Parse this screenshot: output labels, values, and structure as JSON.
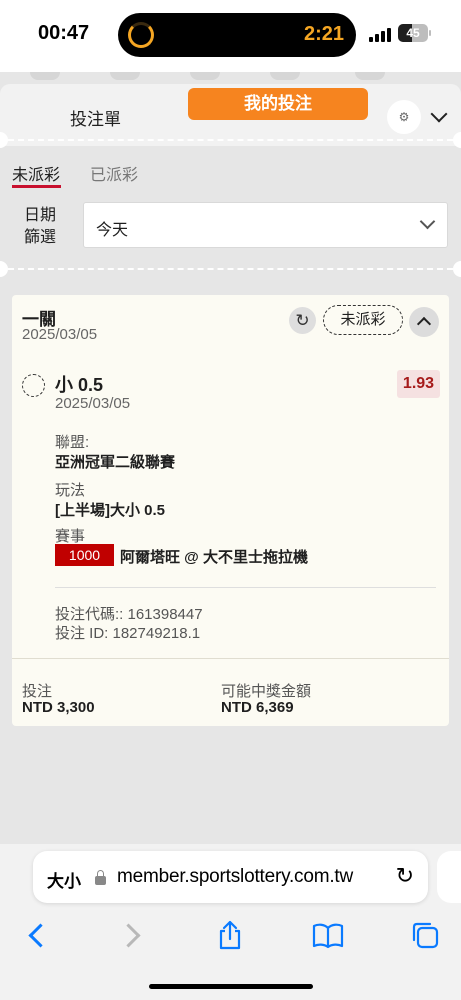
{
  "status_bar": {
    "time": "00:47",
    "timer": "2:21",
    "battery": "45",
    "battery_level": 0.45
  },
  "header": {
    "tab_betslip": "投注單",
    "tab_mybets": "我的投注",
    "settings_icon": "gear-icon",
    "collapse_icon": "chevron-down-icon"
  },
  "subtabs": {
    "unsettled": "未派彩",
    "settled": "已派彩"
  },
  "filter": {
    "label_line1": "日期",
    "label_line2": "篩選",
    "value": "今天"
  },
  "bet": {
    "type": "一關",
    "date": "2025/03/05",
    "status": "未派彩",
    "selection": "小 0.5",
    "selection_date": "2025/03/05",
    "odds": "1.93",
    "league_label": "聯盟:",
    "league": "亞洲冠軍二級聯賽",
    "market_label": "玩法",
    "market": "[上半場]大小 0.5",
    "event_label": "賽事",
    "event_id": "1000",
    "event_name": "阿爾塔旺 @ 大不里士拖拉機",
    "code_line": "投注代碼:: 161398447",
    "id_line": "投注 ID: 182749218.1",
    "stake_label": "投注",
    "stake": "NTD 3,300",
    "payout_label": "可能中獎金額",
    "payout": "NTD 6,369"
  },
  "browser": {
    "text_size": "大小",
    "url": "member.sportslottery.com.tw",
    "icons": [
      "back-icon",
      "forward-icon",
      "share-icon",
      "bookmarks-icon",
      "tabs-icon"
    ]
  },
  "colors": {
    "accent": "#f6841f",
    "active_underline": "#c8102e",
    "event_badge": "#c00000",
    "odds_text": "#a61b1b",
    "link": "#0a7aff"
  }
}
